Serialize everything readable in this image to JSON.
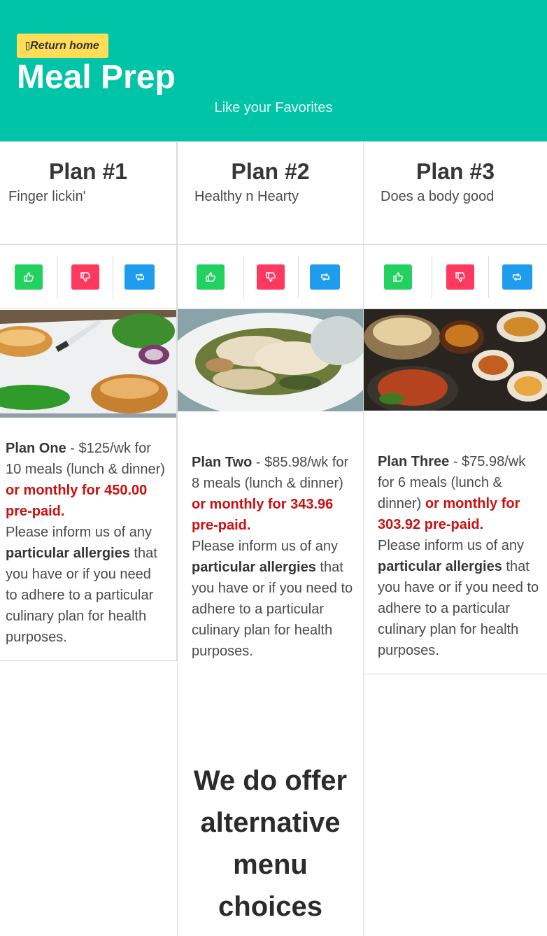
{
  "hero": {
    "home_button": "Return home",
    "title": "Meal Prep",
    "subtitle": "Like your Favorites"
  },
  "colors": {
    "hero_bg": "#00c4a7",
    "home_btn": "#ffdd57",
    "like": "#23d160",
    "dislike": "#ff3860",
    "share": "#209cee",
    "price_highlight": "#cc0f0f"
  },
  "plans": [
    {
      "title": "Plan #1",
      "subtitle": "Finger lickin'",
      "icons": [
        "thumbs-up-icon",
        "thumbs-down-icon",
        "retweet-icon"
      ],
      "name": "Plan One",
      "price": " - $125/wk for 10 meals (lunch & dinner) ",
      "monthly": "or monthly for 450.00 pre-paid.",
      "inform": "Please inform us of any ",
      "allergies": "particular allergies",
      "rest": " that you have or if you need to adhere to a particular culinary plan for health purposes."
    },
    {
      "title": "Plan #2",
      "subtitle": "Healthy n Hearty",
      "icons": [
        "thumbs-up-icon",
        "thumbs-down-icon",
        "retweet-icon"
      ],
      "name": "Plan Two",
      "price": " - $85.98/wk for 8 meals (lunch & dinner) ",
      "monthly": "or monthly for 343.96 pre-paid.",
      "inform": "Please inform us of any ",
      "allergies": "particular allergies",
      "rest": " that you have or if you need to adhere to a particular culinary plan for health purposes."
    },
    {
      "title": "Plan #3",
      "subtitle": "Does a body good",
      "icons": [
        "thumbs-up-icon",
        "thumbs-down-icon",
        "retweet-icon"
      ],
      "name": "Plan Three",
      "price": " - $75.98/wk for 6 meals (lunch & dinner) ",
      "monthly": "or monthly for 303.92 pre-paid.",
      "inform": "Please inform us of any ",
      "allergies": "particular allergies",
      "rest": " that you have or if you need to adhere to a particular culinary plan for health purposes."
    }
  ],
  "alternatives": {
    "heading": "We do offer alternative menu choices"
  }
}
